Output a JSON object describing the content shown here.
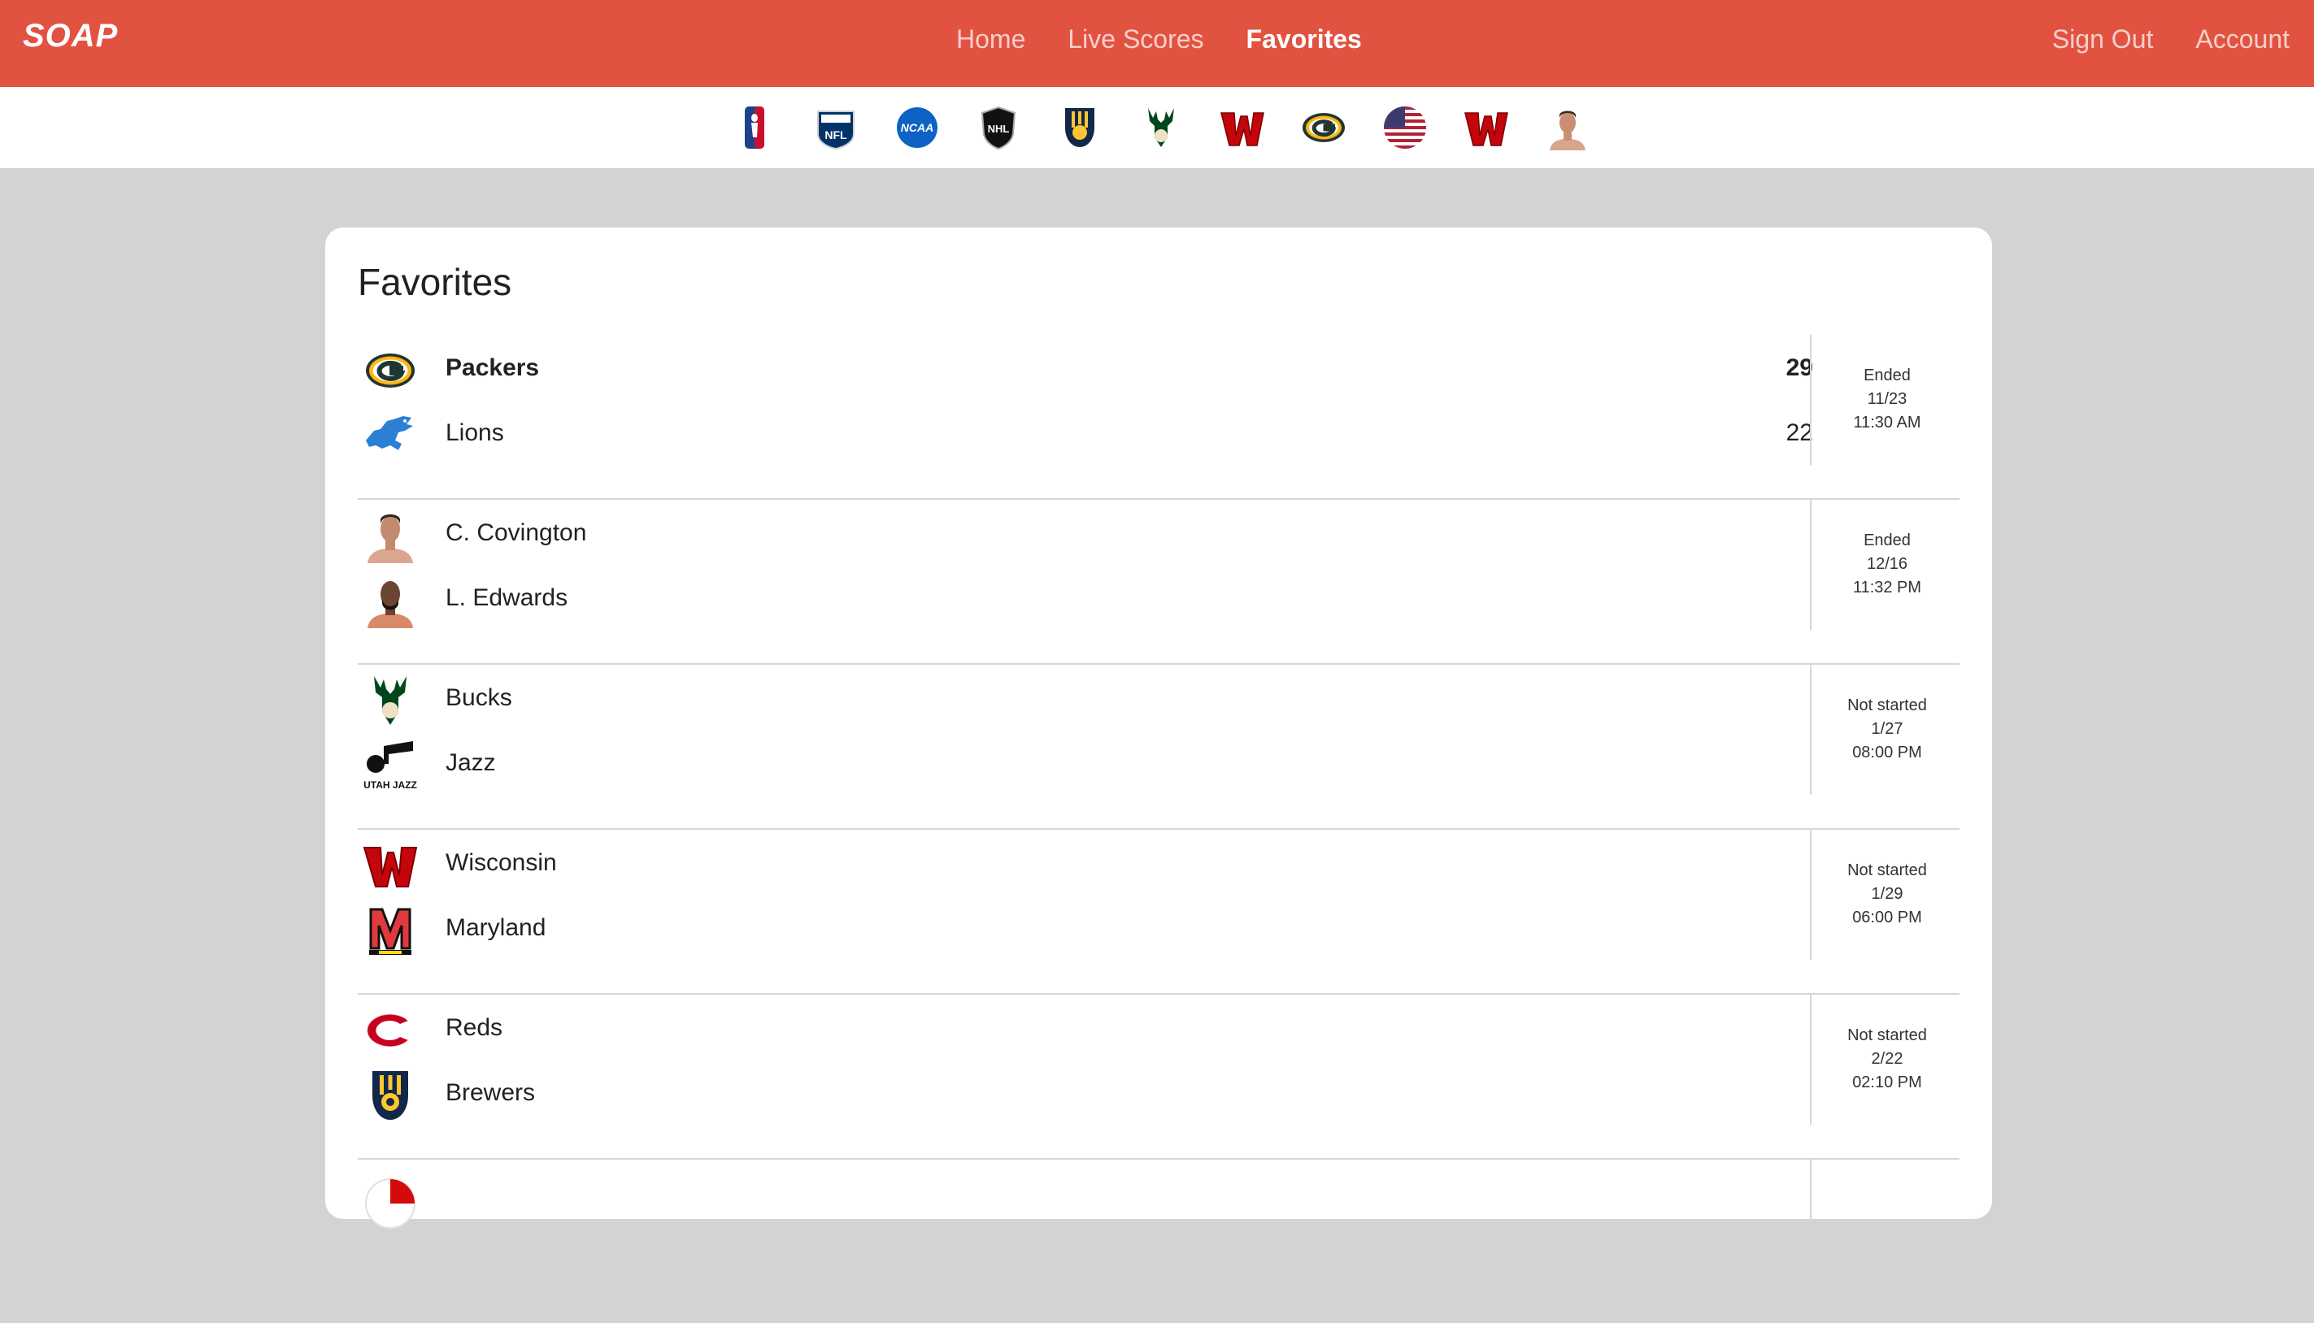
{
  "brand": "SOAP",
  "nav": {
    "home": "Home",
    "live_scores": "Live Scores",
    "favorites": "Favorites",
    "sign_out": "Sign Out",
    "account": "Account"
  },
  "leagues": [
    "nba-icon",
    "nfl-icon",
    "ncaa-icon",
    "nhl-icon",
    "brewers-icon",
    "bucks-icon",
    "wisconsin-icon",
    "packers-icon",
    "usa-flag-icon",
    "wisconsin-icon",
    "fighter-avatar-icon"
  ],
  "page_title": "Favorites",
  "games": [
    {
      "teams": [
        {
          "name": "Packers",
          "score": "29",
          "winner": true,
          "logo": "packers-logo"
        },
        {
          "name": "Lions",
          "score": "22",
          "winner": false,
          "logo": "lions-logo"
        }
      ],
      "status": "Ended",
      "date": "11/23",
      "time": "11:30 AM"
    },
    {
      "teams": [
        {
          "name": "C. Covington",
          "score": "",
          "winner": false,
          "logo": "fighter-photo"
        },
        {
          "name": "L. Edwards",
          "score": "",
          "winner": false,
          "logo": "fighter-photo"
        }
      ],
      "status": "Ended",
      "date": "12/16",
      "time": "11:32 PM"
    },
    {
      "teams": [
        {
          "name": "Bucks",
          "score": "",
          "winner": false,
          "logo": "bucks-logo"
        },
        {
          "name": "Jazz",
          "score": "",
          "winner": false,
          "logo": "jazz-logo"
        }
      ],
      "status": "Not started",
      "date": "1/27",
      "time": "08:00 PM"
    },
    {
      "teams": [
        {
          "name": "Wisconsin",
          "score": "",
          "winner": false,
          "logo": "wisconsin-logo"
        },
        {
          "name": "Maryland",
          "score": "",
          "winner": false,
          "logo": "maryland-logo"
        }
      ],
      "status": "Not started",
      "date": "1/29",
      "time": "06:00 PM"
    },
    {
      "teams": [
        {
          "name": "Reds",
          "score": "",
          "winner": false,
          "logo": "reds-logo"
        },
        {
          "name": "Brewers",
          "score": "",
          "winner": false,
          "logo": "brewers-logo"
        }
      ],
      "status": "Not started",
      "date": "2/22",
      "time": "02:10 PM"
    }
  ],
  "colors": {
    "header": "#e25241",
    "background": "#d3d3d3",
    "card": "#ffffff"
  }
}
